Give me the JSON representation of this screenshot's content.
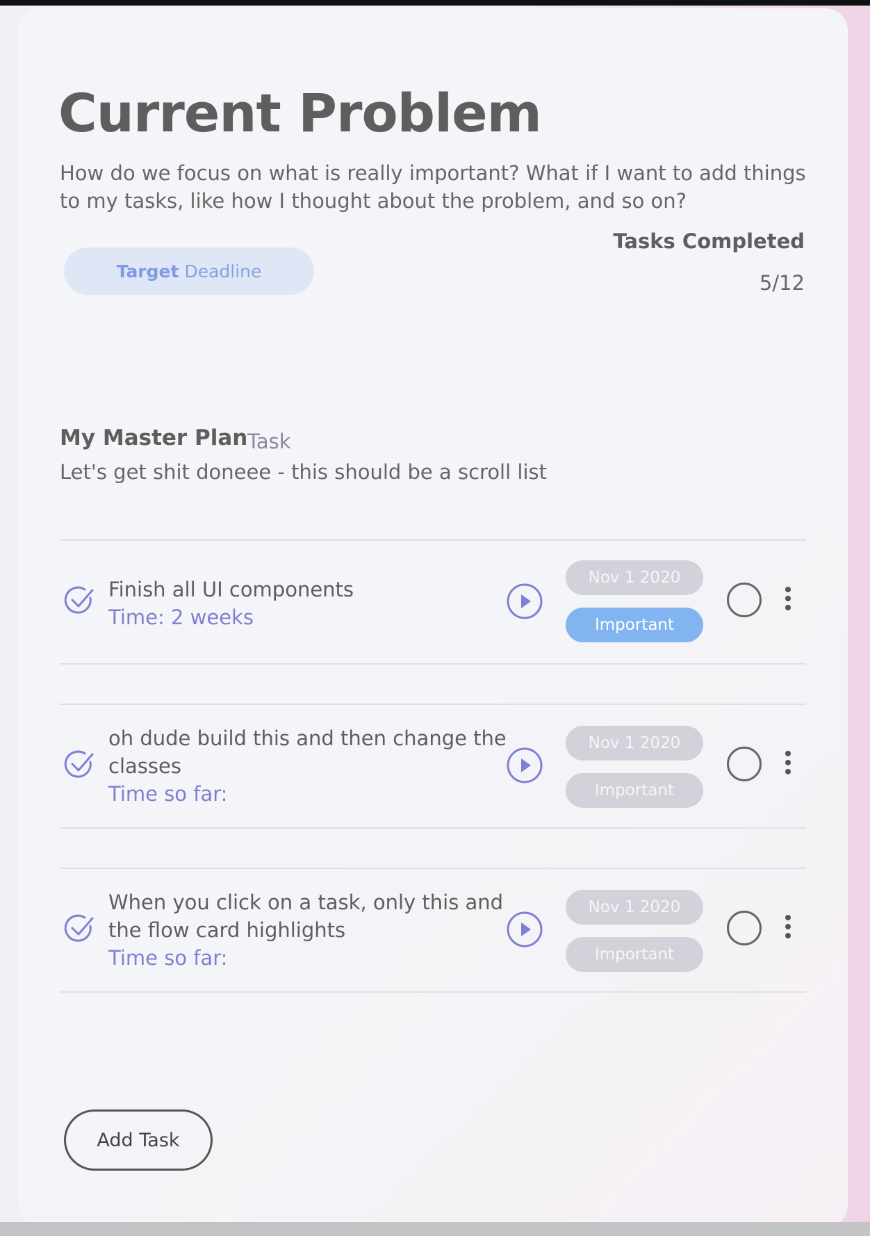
{
  "header": {
    "title": "Current Problem",
    "description": "How do we focus on what is really important? What if I want to add things to my tasks, like how I thought about the problem, and so on?",
    "deadline_strong": "Target",
    "deadline_label": "Deadline",
    "completed_label": "Tasks Completed",
    "completed_count": "5/12",
    "tasks_done": 5,
    "tasks_total": 12
  },
  "plan": {
    "title": "My Master Plan",
    "tag": "Task",
    "description": "Let's get shit doneee - this should be a scroll list"
  },
  "tasks": [
    {
      "text": "Finish all UI components",
      "time": "Time: 2 weeks",
      "date": "Nov 1 2020",
      "priority": "Important",
      "priority_active": true
    },
    {
      "text": "oh dude build this and then change the classes",
      "time": "Time so far:",
      "date": "Nov 1 2020",
      "priority": "Important",
      "priority_active": false
    },
    {
      "text": "When you click on a task, only this and the flow card highlights",
      "time": "Time so far:",
      "date": "Nov 1 2020",
      "priority": "Important",
      "priority_active": false
    }
  ],
  "actions": {
    "add_task_label": "Add Task"
  },
  "colors": {
    "accent": "#7f7fd4",
    "active_tag": "#82b4f0",
    "inactive_tag": "#d2d2da",
    "deadline_pill": "#dfe6f6"
  }
}
